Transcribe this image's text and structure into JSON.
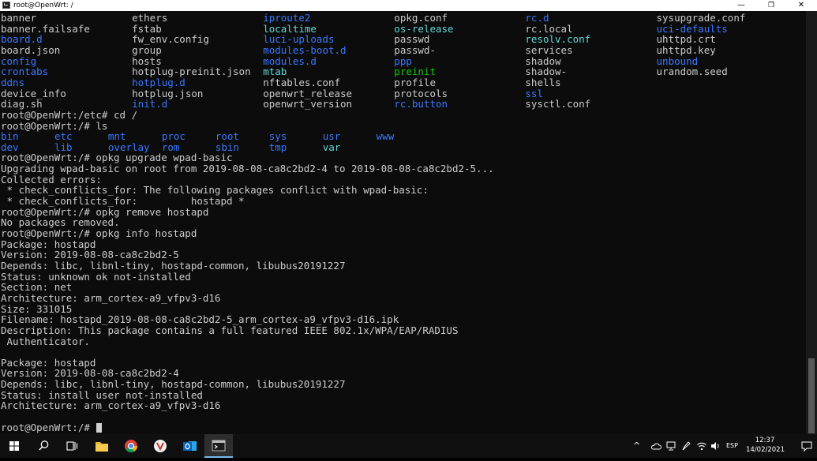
{
  "window": {
    "title": "root@OpenWrt: /",
    "minimize_glyph": "—",
    "maximize_glyph": "❐",
    "close_glyph": "✕"
  },
  "colors": {
    "default": "#cccccc",
    "dir": "#3b78ff",
    "link": "#61d6d6",
    "exec": "#16c60c",
    "white": "#f2f2f2"
  },
  "terminal": {
    "lines": [
      [
        {
          "t": "banner",
          "c": "default",
          "col": 0
        },
        {
          "t": "ethers",
          "c": "default",
          "col": 22
        },
        {
          "t": "iproute2",
          "c": "dir",
          "col": 44
        },
        {
          "t": "opkg.conf",
          "c": "default",
          "col": 66
        },
        {
          "t": "rc.d",
          "c": "dir",
          "col": 88
        },
        {
          "t": "sysupgrade.conf",
          "c": "default",
          "col": 110
        }
      ],
      [
        {
          "t": "banner.failsafe",
          "c": "default",
          "col": 0
        },
        {
          "t": "fstab",
          "c": "default",
          "col": 22
        },
        {
          "t": "localtime",
          "c": "link",
          "col": 44
        },
        {
          "t": "os-release",
          "c": "link",
          "col": 66
        },
        {
          "t": "rc.local",
          "c": "default",
          "col": 88
        },
        {
          "t": "uci-defaults",
          "c": "dir",
          "col": 110
        }
      ],
      [
        {
          "t": "board.d",
          "c": "dir",
          "col": 0
        },
        {
          "t": "fw_env.config",
          "c": "default",
          "col": 22
        },
        {
          "t": "luci-uploads",
          "c": "dir",
          "col": 44
        },
        {
          "t": "passwd",
          "c": "default",
          "col": 66
        },
        {
          "t": "resolv.conf",
          "c": "link",
          "col": 88
        },
        {
          "t": "uhttpd.crt",
          "c": "default",
          "col": 110
        }
      ],
      [
        {
          "t": "board.json",
          "c": "default",
          "col": 0
        },
        {
          "t": "group",
          "c": "default",
          "col": 22
        },
        {
          "t": "modules-boot.d",
          "c": "dir",
          "col": 44
        },
        {
          "t": "passwd-",
          "c": "default",
          "col": 66
        },
        {
          "t": "services",
          "c": "default",
          "col": 88
        },
        {
          "t": "uhttpd.key",
          "c": "default",
          "col": 110
        }
      ],
      [
        {
          "t": "config",
          "c": "dir",
          "col": 0
        },
        {
          "t": "hosts",
          "c": "default",
          "col": 22
        },
        {
          "t": "modules.d",
          "c": "dir",
          "col": 44
        },
        {
          "t": "ppp",
          "c": "dir",
          "col": 66
        },
        {
          "t": "shadow",
          "c": "default",
          "col": 88
        },
        {
          "t": "unbound",
          "c": "dir",
          "col": 110
        }
      ],
      [
        {
          "t": "crontabs",
          "c": "dir",
          "col": 0
        },
        {
          "t": "hotplug-preinit.json",
          "c": "default",
          "col": 22
        },
        {
          "t": "mtab",
          "c": "link",
          "col": 44
        },
        {
          "t": "preinit",
          "c": "exec",
          "col": 66
        },
        {
          "t": "shadow-",
          "c": "default",
          "col": 88
        },
        {
          "t": "urandom.seed",
          "c": "default",
          "col": 110
        }
      ],
      [
        {
          "t": "ddns",
          "c": "dir",
          "col": 0
        },
        {
          "t": "hotplug.d",
          "c": "dir",
          "col": 22
        },
        {
          "t": "nftables.conf",
          "c": "default",
          "col": 44
        },
        {
          "t": "profile",
          "c": "default",
          "col": 66
        },
        {
          "t": "shells",
          "c": "default",
          "col": 88
        }
      ],
      [
        {
          "t": "device_info",
          "c": "default",
          "col": 0
        },
        {
          "t": "hotplug.json",
          "c": "default",
          "col": 22
        },
        {
          "t": "openwrt_release",
          "c": "default",
          "col": 44
        },
        {
          "t": "protocols",
          "c": "default",
          "col": 66
        },
        {
          "t": "ssl",
          "c": "dir",
          "col": 88
        }
      ],
      [
        {
          "t": "diag.sh",
          "c": "default",
          "col": 0
        },
        {
          "t": "init.d",
          "c": "dir",
          "col": 22
        },
        {
          "t": "openwrt_version",
          "c": "default",
          "col": 44
        },
        {
          "t": "rc.button",
          "c": "dir",
          "col": 66
        },
        {
          "t": "sysctl.conf",
          "c": "default",
          "col": 88
        }
      ],
      [
        {
          "t": "root@OpenWrt:/etc# cd /",
          "c": "default",
          "col": 0
        }
      ],
      [
        {
          "t": "root@OpenWrt:/# ls",
          "c": "default",
          "col": 0
        }
      ],
      [
        {
          "t": "bin",
          "c": "dir",
          "col": 0
        },
        {
          "t": "etc",
          "c": "dir",
          "col": 9
        },
        {
          "t": "mnt",
          "c": "dir",
          "col": 18
        },
        {
          "t": "proc",
          "c": "dir",
          "col": 27
        },
        {
          "t": "root",
          "c": "dir",
          "col": 36
        },
        {
          "t": "sys",
          "c": "dir",
          "col": 45
        },
        {
          "t": "usr",
          "c": "dir",
          "col": 54
        },
        {
          "t": "www",
          "c": "dir",
          "col": 63
        }
      ],
      [
        {
          "t": "dev",
          "c": "dir",
          "col": 0
        },
        {
          "t": "lib",
          "c": "dir",
          "col": 9
        },
        {
          "t": "overlay",
          "c": "dir",
          "col": 18
        },
        {
          "t": "rom",
          "c": "dir",
          "col": 27
        },
        {
          "t": "sbin",
          "c": "dir",
          "col": 36
        },
        {
          "t": "tmp",
          "c": "dir",
          "col": 45
        },
        {
          "t": "var",
          "c": "link",
          "col": 54
        }
      ],
      [
        {
          "t": "root@OpenWrt:/# opkg upgrade wpad-basic",
          "c": "default",
          "col": 0
        }
      ],
      [
        {
          "t": "Upgrading wpad-basic on root from 2019-08-08-ca8c2bd2-4 to 2019-08-08-ca8c2bd2-5...",
          "c": "default",
          "col": 0
        }
      ],
      [
        {
          "t": "Collected errors:",
          "c": "default",
          "col": 0
        }
      ],
      [
        {
          "t": " * check_conflicts_for: The following packages conflict with wpad-basic:",
          "c": "default",
          "col": 0
        }
      ],
      [
        {
          "t": " * check_conflicts_for:         hostapd *",
          "c": "default",
          "col": 0
        }
      ],
      [
        {
          "t": "root@OpenWrt:/# opkg remove hostapd",
          "c": "default",
          "col": 0
        }
      ],
      [
        {
          "t": "No packages removed.",
          "c": "default",
          "col": 0
        }
      ],
      [
        {
          "t": "root@OpenWrt:/# opkg info hostapd",
          "c": "default",
          "col": 0
        }
      ],
      [
        {
          "t": "Package: hostapd",
          "c": "default",
          "col": 0
        }
      ],
      [
        {
          "t": "Version: 2019-08-08-ca8c2bd2-5",
          "c": "default",
          "col": 0
        }
      ],
      [
        {
          "t": "Depends: libc, libnl-tiny, hostapd-common, libubus20191227",
          "c": "default",
          "col": 0
        }
      ],
      [
        {
          "t": "Status: unknown ok not-installed",
          "c": "default",
          "col": 0
        }
      ],
      [
        {
          "t": "Section: net",
          "c": "default",
          "col": 0
        }
      ],
      [
        {
          "t": "Architecture: arm_cortex-a9_vfpv3-d16",
          "c": "default",
          "col": 0
        }
      ],
      [
        {
          "t": "Size: 331015",
          "c": "default",
          "col": 0
        }
      ],
      [
        {
          "t": "Filename: hostapd_2019-08-08-ca8c2bd2-5_arm_cortex-a9_vfpv3-d16.ipk",
          "c": "default",
          "col": 0
        }
      ],
      [
        {
          "t": "Description: This package contains a full featured IEEE 802.1x/WPA/EAP/RADIUS",
          "c": "default",
          "col": 0
        }
      ],
      [
        {
          "t": " Authenticator.",
          "c": "default",
          "col": 0
        }
      ],
      [],
      [
        {
          "t": "Package: hostapd",
          "c": "default",
          "col": 0
        }
      ],
      [
        {
          "t": "Version: 2019-08-08-ca8c2bd2-4",
          "c": "default",
          "col": 0
        }
      ],
      [
        {
          "t": "Depends: libc, libnl-tiny, hostapd-common, libubus20191227",
          "c": "default",
          "col": 0
        }
      ],
      [
        {
          "t": "Status: install user not-installed",
          "c": "default",
          "col": 0
        }
      ],
      [
        {
          "t": "Architecture: arm_cortex-a9_vfpv3-d16",
          "c": "default",
          "col": 0
        }
      ],
      [],
      [
        {
          "t": "root@OpenWrt:/# ",
          "c": "default",
          "col": 0,
          "cursor": true
        }
      ]
    ]
  },
  "taskbar": {
    "language": "ESP",
    "time": "12:37",
    "date": "14/02/2021",
    "show_hidden_glyph": "^"
  }
}
